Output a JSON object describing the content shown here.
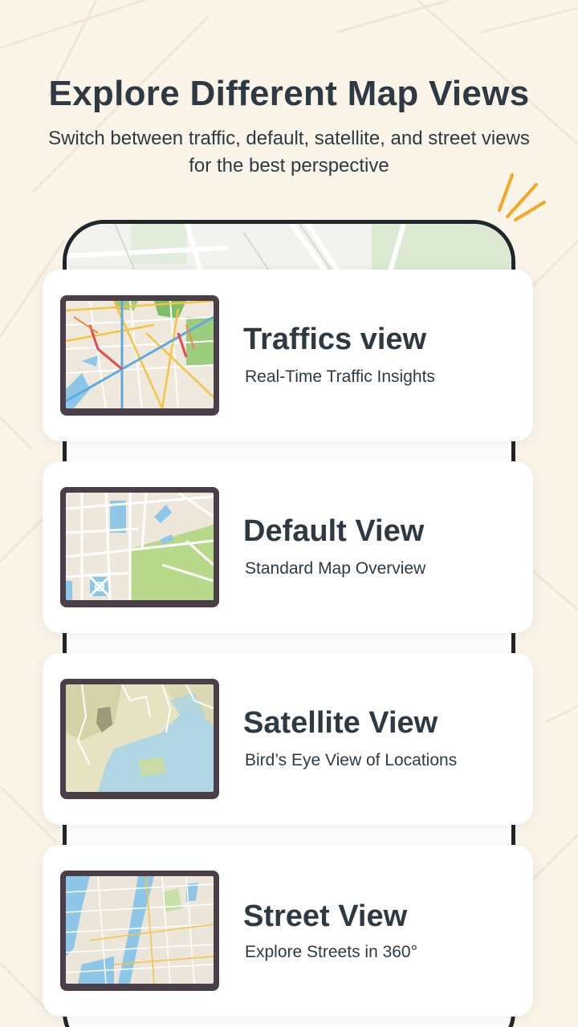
{
  "header": {
    "title": "Explore Different Map Views",
    "subtitle": "Switch between traffic, default, satellite, and street views for the best perspective"
  },
  "views": [
    {
      "title": "Traffics view",
      "subtitle": "Real-Time Traffic Insights",
      "thumbnail": "traffic-map-thumbnail"
    },
    {
      "title": "Default View",
      "subtitle": "Standard Map Overview",
      "thumbnail": "default-map-thumbnail"
    },
    {
      "title": "Satellite View",
      "subtitle": "Bird’s Eye View of Locations",
      "thumbnail": "satellite-map-thumbnail"
    },
    {
      "title": "Street View",
      "subtitle": "Explore Streets in 360°",
      "thumbnail": "street-map-thumbnail"
    }
  ],
  "colors": {
    "background": "#fbf4e9",
    "text": "#2d3a44",
    "accent": "#f5a623",
    "phone_frame": "#1f262c",
    "thumb_frame": "#4a3f48"
  }
}
